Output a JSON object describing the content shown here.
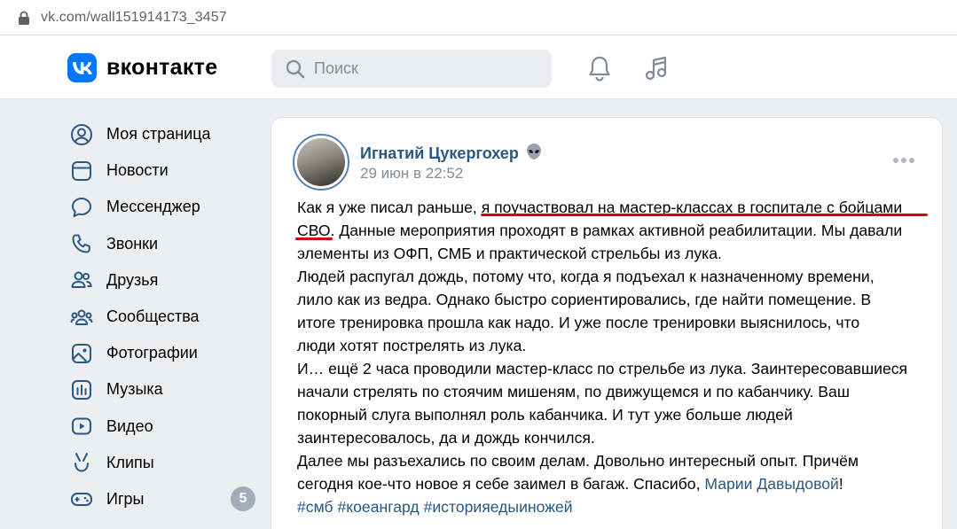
{
  "browser": {
    "url": "vk.com/wall151914173_3457"
  },
  "header": {
    "brand": "вконтакте",
    "search_placeholder": "Поиск"
  },
  "sidebar": {
    "items": [
      {
        "label": "Моя страница",
        "icon": "user-circle-icon"
      },
      {
        "label": "Новости",
        "icon": "news-icon"
      },
      {
        "label": "Мессенджер",
        "icon": "chat-bubble-icon"
      },
      {
        "label": "Звонки",
        "icon": "phone-icon"
      },
      {
        "label": "Друзья",
        "icon": "friends-icon"
      },
      {
        "label": "Сообщества",
        "icon": "communities-icon"
      },
      {
        "label": "Фотографии",
        "icon": "photo-icon"
      },
      {
        "label": "Музыка",
        "icon": "music-icon"
      },
      {
        "label": "Видео",
        "icon": "video-icon"
      },
      {
        "label": "Клипы",
        "icon": "clips-icon"
      },
      {
        "label": "Игры",
        "icon": "gamepad-icon",
        "badge": "5"
      }
    ]
  },
  "post": {
    "author": "Игнатий Цукергохер",
    "author_emoji": "👽",
    "date": "29 июн в 22:52",
    "text": {
      "l1a": "Как я уже писал раньше, ",
      "l1b": "я поучаствовал на мастер-классах в госпитале с бойцами",
      "l2a": "СВО.",
      "l2b": " Данные мероприятия проходят в рамках активной реабилитации. Мы давали",
      "l3": "элементы из ОФП, СМБ и практической стрельбы из лука.",
      "l4": "Людей распугал дождь, потому что, когда я подъехал к назначенному времени,",
      "l5": "лило как из ведра. Однако быстро сориентировались, где найти помещение. В",
      "l6": "итоге тренировка прошла как надо. И уже после тренировки выяснилось, что",
      "l7": "люди хотят пострелять из лука.",
      "l8": "И… ещё 2 часа проводили мастер-класс по стрельбе из лука. Заинтересовавшиеся",
      "l9": "начали стрелять по стоячим мишеням, по движущемся и по кабанчику. Ваш",
      "l10": "покорный слуга выполнял роль кабанчика. И тут уже больше людей",
      "l11": "заинтересовалось, да и дождь кончился.",
      "l12": "Далее мы разъехались по своим делам. Довольно интересный опыт. Причём",
      "l13a": "сегодня кое-что новое я себе заимел в багаж. Спасибо, ",
      "l13_link": "Марии Давыдовой",
      "l13b": "!"
    },
    "hashtags": [
      "#смб",
      "#коеангард",
      "#историяедыиножей"
    ]
  },
  "colors": {
    "vk_blue": "#0077ff",
    "link": "#2a5885",
    "annotation_red": "#d4000d"
  }
}
